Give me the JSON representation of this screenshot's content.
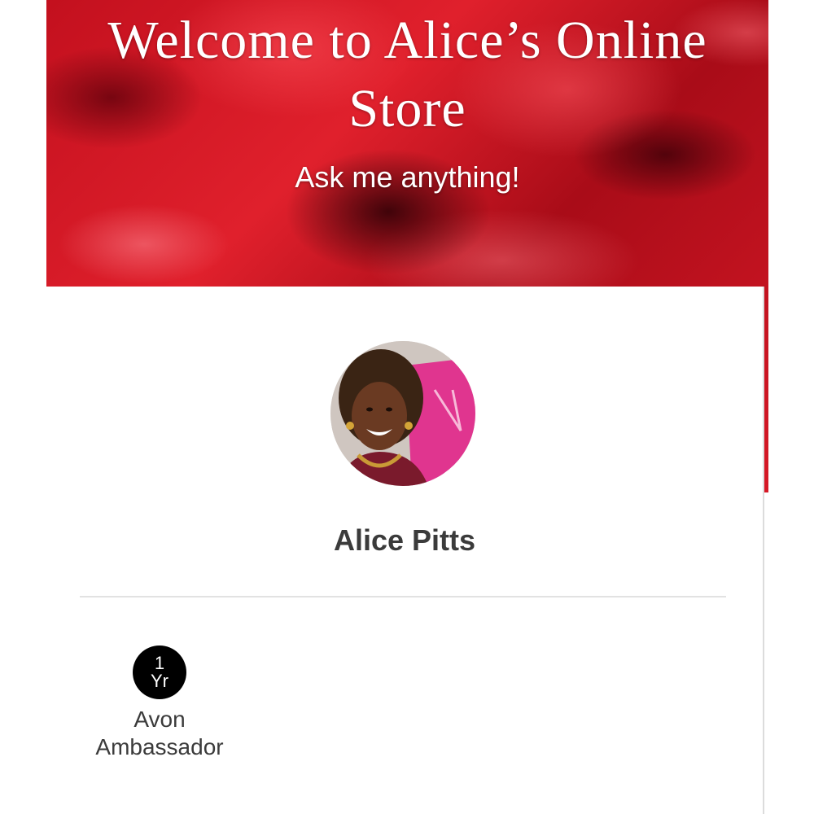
{
  "hero": {
    "title": "Welcome to Alice’s Online Store",
    "subtitle": "Ask me anything!"
  },
  "profile": {
    "name": "Alice Pitts",
    "avatar_icon": "profile-photo"
  },
  "badge": {
    "number": "1",
    "unit": "Yr",
    "caption_line1": "Avon",
    "caption_line2": "Ambassador"
  },
  "colors": {
    "hero_red": "#d61826",
    "text_dark": "#3b3b3b",
    "badge_bg": "#000000"
  }
}
